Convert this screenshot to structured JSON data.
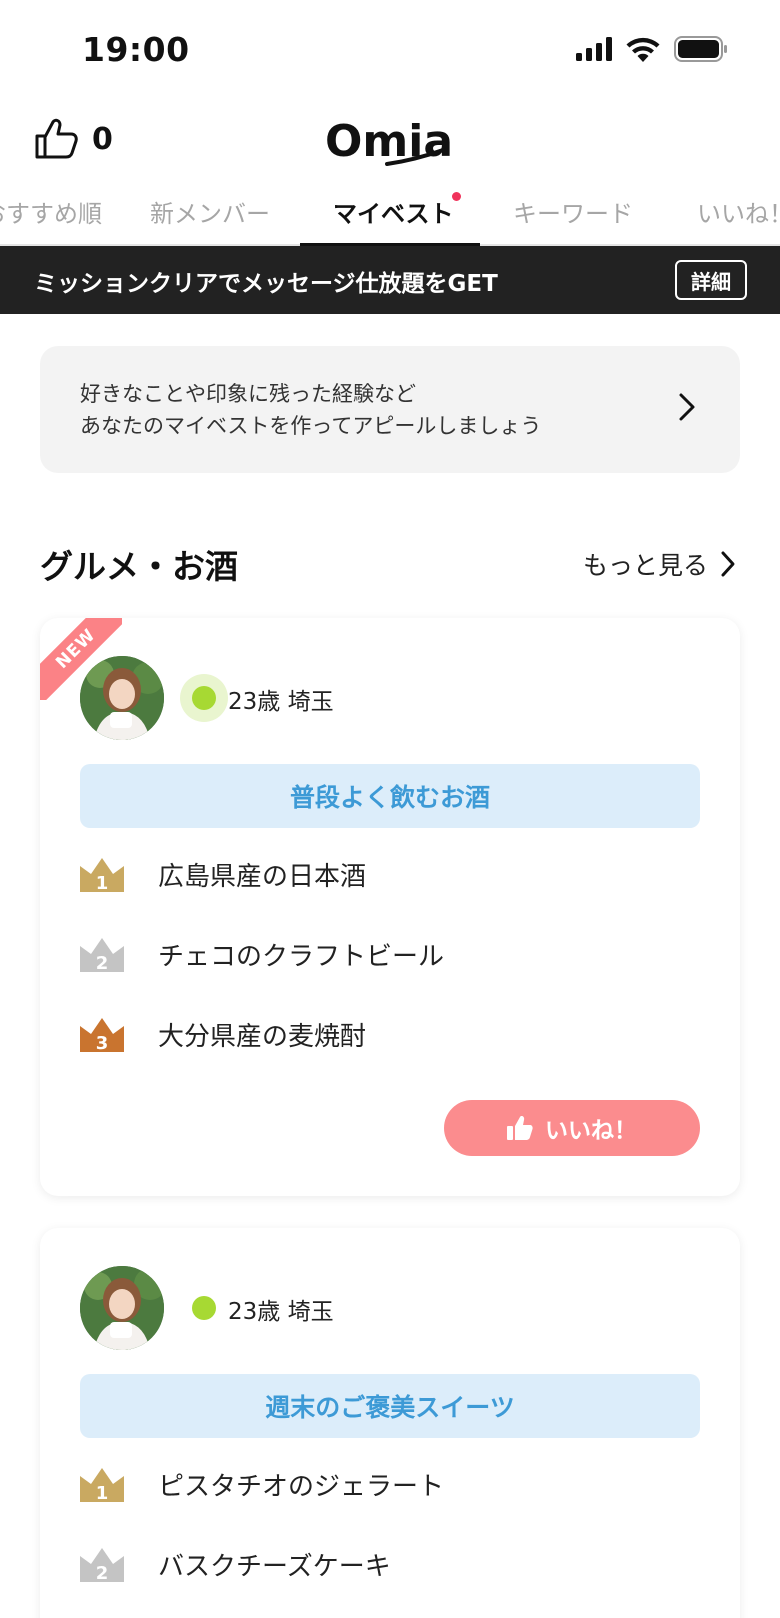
{
  "status_bar": {
    "time": "19:00"
  },
  "header": {
    "like_count": "0",
    "logo_text": "Omiai"
  },
  "tabs": [
    {
      "label": "おすすめ順",
      "active": false
    },
    {
      "label": "新メンバー",
      "active": false
    },
    {
      "label": "マイベスト",
      "active": true,
      "badge": true
    },
    {
      "label": "キーワード",
      "active": false
    },
    {
      "label": "いいね！",
      "active": false
    }
  ],
  "banner": {
    "text": "ミッションクリアでメッセージ仕放題をGET",
    "button": "詳細"
  },
  "prompt": {
    "line1": "好きなことや印象に残った経験など",
    "line2": "あなたのマイベストを作ってアピールしましょう"
  },
  "section": {
    "title": "グルメ・お酒",
    "more": "もっと見る"
  },
  "cards": [
    {
      "ribbon": "NEW",
      "user": "23歳 埼玉",
      "topic": "普段よく飲むお酒",
      "ranks": [
        {
          "num": "1",
          "text": "広島県産の日本酒"
        },
        {
          "num": "2",
          "text": "チェコのクラフトビール"
        },
        {
          "num": "3",
          "text": "大分県産の麦焼酎"
        }
      ],
      "like_button": "いいね！"
    },
    {
      "user": "23歳 埼玉",
      "topic": "週末のご褒美スイーツ",
      "ranks": [
        {
          "num": "1",
          "text": "ピスタチオのジェラート"
        },
        {
          "num": "2",
          "text": "バスクチーズケーキ"
        }
      ]
    }
  ],
  "colors": {
    "gold": "#c9a961",
    "silver": "#c4c4c4",
    "bronze": "#c9742f",
    "accent_pink": "#fb8c8e",
    "topic_blue": "#3d9ad6",
    "online_green": "#a7d933"
  }
}
